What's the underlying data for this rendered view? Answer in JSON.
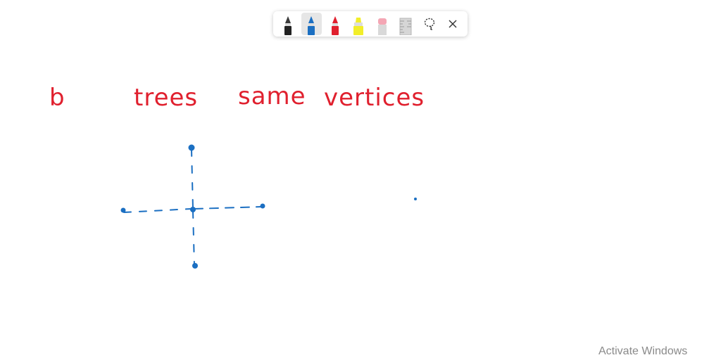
{
  "toolbar": {
    "tools": [
      {
        "name": "ballpoint-pen-black",
        "icon": "pen-icon",
        "color": "#222222",
        "selected": false
      },
      {
        "name": "ballpoint-pen-blue",
        "icon": "pen-icon",
        "color": "#1b6fc2",
        "selected": true
      },
      {
        "name": "ballpoint-pen-red",
        "icon": "pen-icon",
        "color": "#e0202e",
        "selected": false
      },
      {
        "name": "highlighter-yellow",
        "icon": "highlighter-icon",
        "color": "#f2ee2a",
        "selected": false
      },
      {
        "name": "eraser",
        "icon": "eraser-icon",
        "color": "#f4a6b4",
        "selected": false
      },
      {
        "name": "ruler",
        "icon": "ruler-icon",
        "selected": false
      },
      {
        "name": "lasso-select",
        "icon": "lasso-icon",
        "selected": false
      },
      {
        "name": "close",
        "icon": "close-icon",
        "selected": false
      }
    ]
  },
  "ink": {
    "words": [
      "b",
      "trees",
      "same",
      "vertices"
    ],
    "text_color": "#e0202e",
    "diagram_color": "#1b6fc2"
  },
  "watermark": {
    "text": "Activate Windows"
  }
}
